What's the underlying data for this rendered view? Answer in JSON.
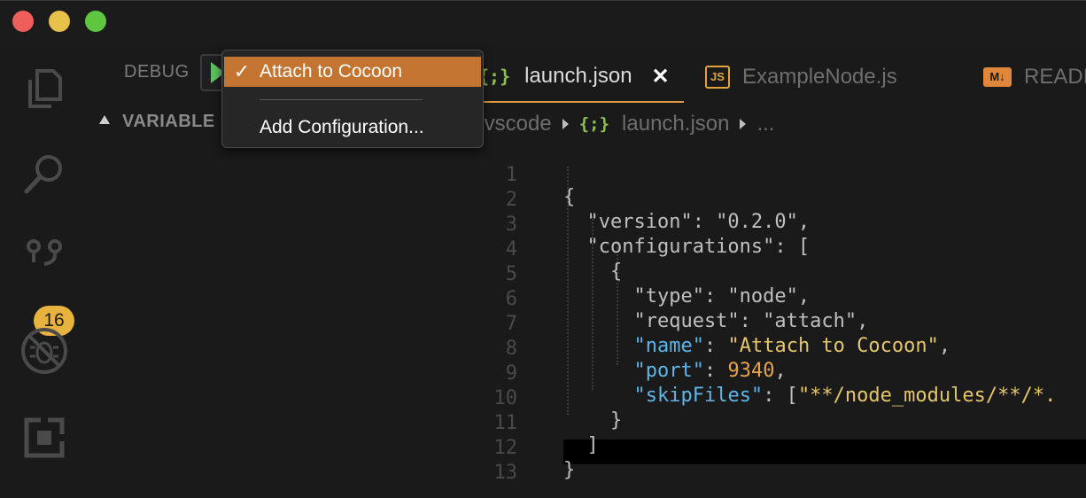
{
  "window": {
    "controls": [
      "close",
      "minimize",
      "zoom"
    ]
  },
  "activity_bar": {
    "items": [
      {
        "name": "explorer-icon"
      },
      {
        "name": "search-icon"
      },
      {
        "name": "source-control-icon",
        "badge": "16"
      },
      {
        "name": "debug-icon"
      },
      {
        "name": "extensions-icon"
      }
    ]
  },
  "debug_panel": {
    "label": "DEBUG",
    "section_title": "VARIABLE"
  },
  "config_dropdown": {
    "selected": "Attach to Cocoon",
    "check": "✓",
    "add_configuration": "Add Configuration..."
  },
  "tabs": [
    {
      "icon": "{;}",
      "label": "launch.json",
      "close": "✕",
      "active": true
    },
    {
      "icon": "JS",
      "label": "ExampleNode.js",
      "active": false
    },
    {
      "icon": "M↓",
      "label": "READI",
      "active": false
    }
  ],
  "breadcrumb": {
    "folder": ".vscode",
    "icon": "{;}",
    "file": "launch.json",
    "more": "..."
  },
  "editor": {
    "line_numbers": [
      "1",
      "2",
      "3",
      "4",
      "5",
      "6",
      "7",
      "8",
      "9",
      "10",
      "11",
      "12",
      "13"
    ],
    "lines": [
      "{",
      "  \"version\": \"0.2.0\",",
      "  \"configurations\": [",
      "    {",
      "      \"type\": \"node\",",
      "      \"request\": \"attach\",",
      "      \"name\": \"Attach to Cocoon\",",
      "      \"port\": 9340,",
      "      \"skipFiles\": [\"**/node_modules/**/*.",
      "    }",
      "  ]",
      "}",
      ""
    ]
  },
  "colors": {
    "accent": "#c47431",
    "tab_underline": "#e09a42",
    "badge": "#e7b23e",
    "key_cyan": "#5fb5e8",
    "string_yellow": "#e5c66b",
    "number_orange": "#e9a24c",
    "json_icon": "#8cc052"
  }
}
